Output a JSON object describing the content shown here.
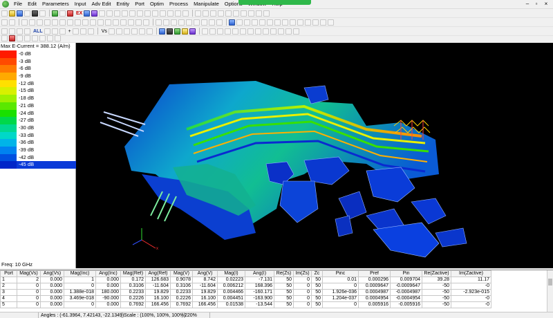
{
  "menu": {
    "items": [
      "File",
      "Edit",
      "Parameters",
      "Input",
      "Adv Edit",
      "Entity",
      "Port",
      "Optim",
      "Process",
      "Manipulate",
      "Options",
      "Window",
      "Help"
    ]
  },
  "toolbar": {
    "all_label": "ALL",
    "vs_label": "Vs",
    "plus_label": "+",
    "ex_label": "EX"
  },
  "legend": {
    "title": "Max E-Current = 388.12 (A/m)",
    "levels": [
      {
        "label": "-0 dB",
        "color": "#ff1a00"
      },
      {
        "label": "-3 dB",
        "color": "#ff4a00"
      },
      {
        "label": "-6 dB",
        "color": "#ff7a00"
      },
      {
        "label": "-9 dB",
        "color": "#ffaa00"
      },
      {
        "label": "-12 dB",
        "color": "#ffe000"
      },
      {
        "label": "-15 dB",
        "color": "#d8f000"
      },
      {
        "label": "-18 dB",
        "color": "#9ef000"
      },
      {
        "label": "-21 dB",
        "color": "#5ae800"
      },
      {
        "label": "-24 dB",
        "color": "#19e000"
      },
      {
        "label": "-27 dB",
        "color": "#00d84a"
      },
      {
        "label": "-30 dB",
        "color": "#00d890"
      },
      {
        "label": "-33 dB",
        "color": "#00d8c8"
      },
      {
        "label": "-36 dB",
        "color": "#00b4e8"
      },
      {
        "label": "-39 dB",
        "color": "#0082f0"
      },
      {
        "label": "-42 dB",
        "color": "#0050e0"
      },
      {
        "label": "-45 dB",
        "color": "#0026c8"
      }
    ],
    "selected_index": 15,
    "freq": "Freq: 10 GHz"
  },
  "table": {
    "columns": [
      "Port",
      "Mag(Vs)",
      "Ang(Vs)",
      "Mag(Inc)",
      "Ang(Inc)",
      "Mag(Ref)",
      "Ang(Ref)",
      "Mag(V)",
      "Ang(V)",
      "Mag(I)",
      "Ang(I)",
      "Re(Zs)",
      "Im(Zs)",
      "Zc",
      "Pinc",
      "Pref",
      "Pin",
      "Re(Zactive)",
      "Im(Zactive)"
    ],
    "rows": [
      [
        "1",
        "2",
        "0.000",
        "1",
        "0.000",
        "0.172",
        "126.683",
        "0.9078",
        "8.742",
        "0.02223",
        "-7.131",
        "50",
        "0",
        "50",
        "0.01",
        "0.000296",
        "0.009704",
        "39.28",
        "11.17"
      ],
      [
        "2",
        "0",
        "0.000",
        "0",
        "0.000",
        "0.3106",
        "-11.604",
        "0.3106",
        "-11.604",
        "0.006212",
        "168.396",
        "50",
        "0",
        "50",
        "0",
        "0.0009647",
        "-0.0009647",
        "-50",
        "-0"
      ],
      [
        "3",
        "0",
        "0.000",
        "1.388e-018",
        "180.000",
        "0.2233",
        "19.829",
        "0.2233",
        "19.829",
        "0.004466",
        "-160.171",
        "50",
        "0",
        "50",
        "1.926e-036",
        "0.0004987",
        "-0.0004987",
        "-50",
        "-2.923e-015"
      ],
      [
        "4",
        "0",
        "0.000",
        "3.469e-018",
        "-90.000",
        "0.2226",
        "16.100",
        "0.2226",
        "16.100",
        "0.004451",
        "-163.900",
        "50",
        "0",
        "50",
        "1.204e-037",
        "0.0004954",
        "-0.0004954",
        "-50",
        "-0"
      ],
      [
        "5",
        "0",
        "0.000",
        "0",
        "0.000",
        "0.7692",
        "166.456",
        "0.7692",
        "166.456",
        "0.01538",
        "-13.544",
        "50",
        "0",
        "50",
        "0",
        "0.005916",
        "-0.005916",
        "-50",
        "-0"
      ]
    ]
  },
  "status": {
    "angles": "Angles : (-61.3964, 7.42143, -22.1349)",
    "scale": "Scale : (100%, 100%, 100%)",
    "zoom": "220%"
  }
}
